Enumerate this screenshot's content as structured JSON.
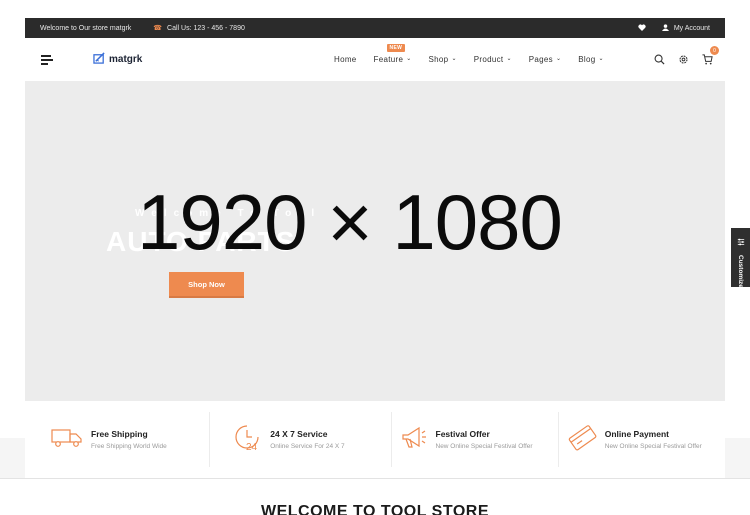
{
  "topbar": {
    "welcome": "Welcome to Our store matgrk",
    "phone": "Call Us: 123 - 456 - 7890",
    "account": "My Account"
  },
  "header": {
    "logo": "matgrk",
    "nav": [
      {
        "label": "Home"
      },
      {
        "label": "Feature",
        "badge": "NEW"
      },
      {
        "label": "Shop"
      },
      {
        "label": "Product"
      },
      {
        "label": "Pages"
      },
      {
        "label": "Blog"
      }
    ],
    "cart_count": "0"
  },
  "hero": {
    "placeholder": "1920 × 1080",
    "subtitle": "Welcome To Tool",
    "title": "AUTO PARTS",
    "button": "Shop Now"
  },
  "side_tab": {
    "label": "Customize"
  },
  "features": [
    {
      "icon": "truck-icon",
      "title": "Free Shipping",
      "desc": "Free Shipping World Wide"
    },
    {
      "icon": "clock-24-icon",
      "title": "24 X 7 Service",
      "desc": "Online Service For 24 X 7"
    },
    {
      "icon": "megaphone-icon",
      "title": "Festival Offer",
      "desc": "New Online Special Festival Offer"
    },
    {
      "icon": "credit-card-icon",
      "title": "Online Payment",
      "desc": "New Online Special Festival Offer"
    }
  ],
  "section": {
    "title": "WELCOME TO TOOL STORE"
  },
  "colors": {
    "accent": "#ee8a4f",
    "topbar": "#2b2b2b",
    "hero_bg": "#ececec"
  }
}
